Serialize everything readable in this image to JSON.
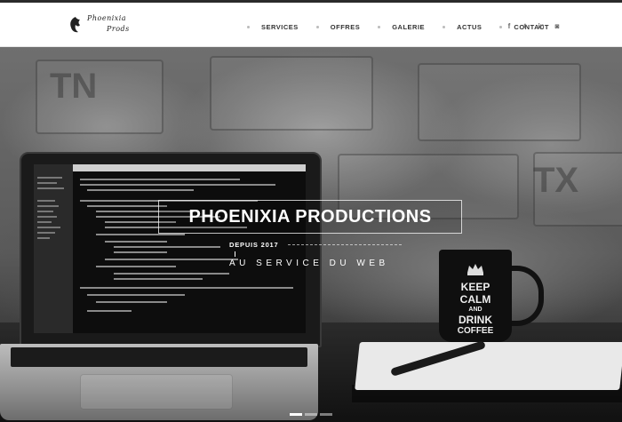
{
  "brand": {
    "logo_line1": "Phoenixia",
    "logo_line2": "Prods"
  },
  "nav": {
    "items": [
      {
        "label": "SERVICES"
      },
      {
        "label": "OFFRES"
      },
      {
        "label": "GALERIE"
      },
      {
        "label": "ACTUS"
      },
      {
        "label": "CONTACT"
      }
    ]
  },
  "social": {
    "icons": [
      "facebook-icon",
      "twitter-icon",
      "linkedin-icon",
      "instagram-icon"
    ],
    "glyphs": [
      "f",
      "t",
      "in",
      "◙"
    ]
  },
  "hero": {
    "title": "PHOENIXIA PRODUCTIONS",
    "tagline": "DEPUIS 2017",
    "subtitle": "AU SERVICE DU WEB",
    "mug_text": [
      "KEEP",
      "CALM",
      "AND",
      "DRINK",
      "COFFEE"
    ]
  },
  "slider": {
    "count": 3,
    "active_index": 0
  },
  "colors": {
    "header_bg": "#ffffff",
    "nav_text": "#333333",
    "hero_text": "#ffffff"
  }
}
